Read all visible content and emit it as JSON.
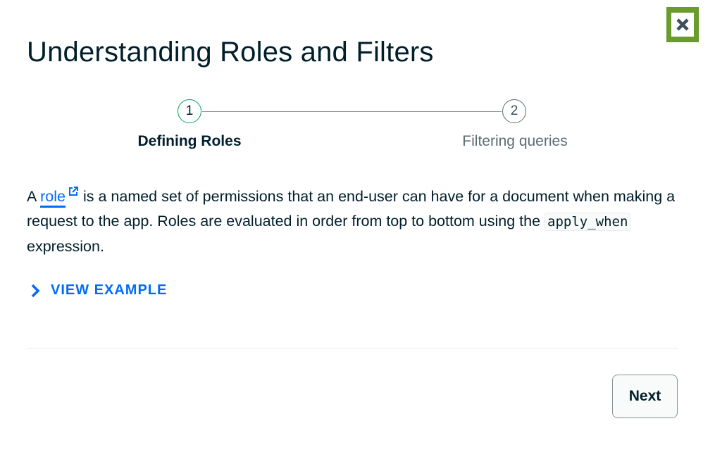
{
  "modal": {
    "title": "Understanding Roles and Filters",
    "close_icon": "close-icon"
  },
  "stepper": {
    "steps": [
      {
        "number": "1",
        "label": "Defining Roles",
        "state": "active"
      },
      {
        "number": "2",
        "label": "Filtering queries",
        "state": "inactive"
      }
    ]
  },
  "content": {
    "prefix": "A ",
    "link_text": "role",
    "link_icon": "external-link-icon",
    "text_after_link": " is a named set of permissions that an end-user can have for a document when making a request to the app. Roles are evaluated in order from top to bottom using the ",
    "code": "apply_when",
    "text_after_code": " expression."
  },
  "view_example": {
    "label": "VIEW EXAMPLE",
    "icon": "chevron-right-icon"
  },
  "footer": {
    "next_label": "Next"
  },
  "colors": {
    "accent_blue": "#016bf8",
    "close_button_bg": "#6b9a2d",
    "step_active_border": "#00a35c",
    "text_primary": "#001e2b",
    "text_muted": "#5c6c75"
  }
}
